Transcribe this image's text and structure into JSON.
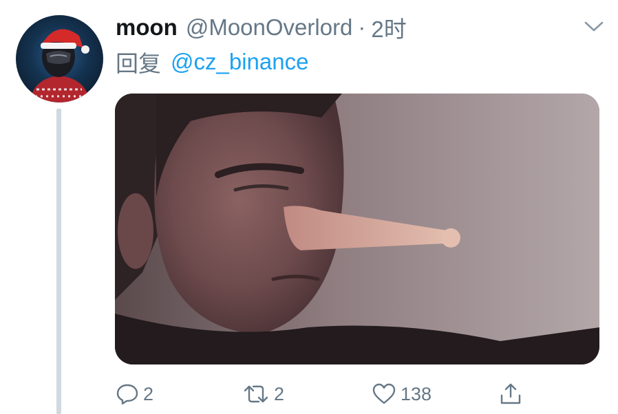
{
  "tweet": {
    "author": {
      "display_name": "moon",
      "handle": "@MoonOverlord"
    },
    "separator": "·",
    "time": "2时",
    "reply_prefix": "回复",
    "reply_to": "@cz_binance",
    "actions": {
      "reply_count": "2",
      "retweet_count": "2",
      "like_count": "138"
    }
  },
  "icons": {
    "menu": "chevron-down-icon",
    "reply": "speech-bubble-icon",
    "retweet": "retweet-arrows-icon",
    "like": "heart-icon",
    "share": "share-upload-icon"
  },
  "colors": {
    "text_primary": "#14171a",
    "text_secondary": "#657786",
    "link": "#1da1f2",
    "thread_line": "#cfd9de"
  }
}
